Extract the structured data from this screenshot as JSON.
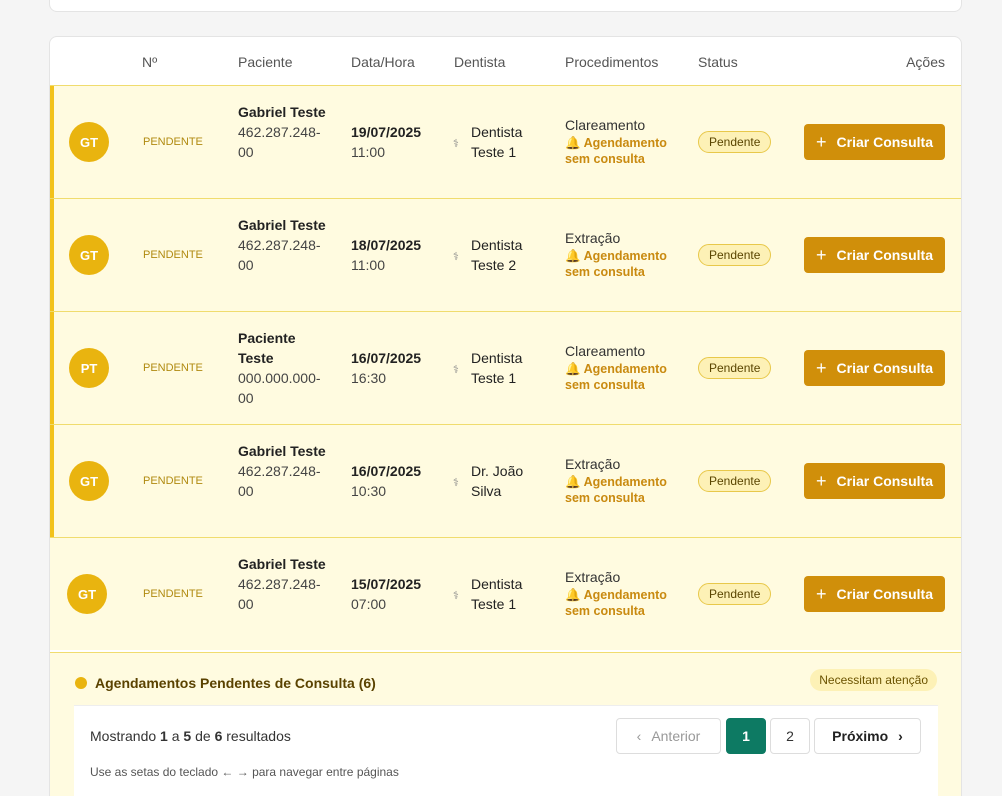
{
  "table": {
    "headers": {
      "num": "Nº",
      "patient": "Paciente",
      "datetime": "Data/Hora",
      "dentist": "Dentista",
      "procedures": "Procedimentos",
      "status": "Status",
      "actions": "Ações"
    },
    "rows": [
      {
        "initials": "GT",
        "num": "PENDENTE",
        "name": "Gabriel Teste",
        "cpf": "462.287.248-00",
        "date": "19/07/2025",
        "time": "11:00",
        "dentist": "Dentista Teste 1",
        "procedure": "Clareamento",
        "warning": "🔔 Agendamento sem consulta",
        "status": "Pendente",
        "action": "Criar Consulta"
      },
      {
        "initials": "GT",
        "num": "PENDENTE",
        "name": "Gabriel Teste",
        "cpf": "462.287.248-00",
        "date": "18/07/2025",
        "time": "11:00",
        "dentist": "Dentista Teste 2",
        "procedure": "Extração",
        "warning": "🔔 Agendamento sem consulta",
        "status": "Pendente",
        "action": "Criar Consulta"
      },
      {
        "initials": "PT",
        "num": "PENDENTE",
        "name": "Paciente Teste",
        "cpf": "000.000.000-00",
        "date": "16/07/2025",
        "time": "16:30",
        "dentist": "Dentista Teste 1",
        "procedure": "Clareamento",
        "warning": "🔔 Agendamento sem consulta",
        "status": "Pendente",
        "action": "Criar Consulta"
      },
      {
        "initials": "GT",
        "num": "PENDENTE",
        "name": "Gabriel Teste",
        "cpf": "462.287.248-00",
        "date": "16/07/2025",
        "time": "10:30",
        "dentist": "Dr. João Silva",
        "procedure": "Extração",
        "warning": "🔔 Agendamento sem consulta",
        "status": "Pendente",
        "action": "Criar Consulta"
      },
      {
        "initials": "GT",
        "num": "PENDENTE",
        "name": "Gabriel Teste",
        "cpf": "462.287.248-00",
        "date": "15/07/2025",
        "time": "07:00",
        "dentist": "Dentista Teste 1",
        "procedure": "Extração",
        "warning": "🔔 Agendamento sem consulta",
        "status": "Pendente",
        "action": "Criar Consulta"
      }
    ]
  },
  "summary": {
    "title": "Agendamentos Pendentes de Consulta (6)",
    "attention": "Necessitam atenção"
  },
  "pagination": {
    "showing_prefix": "Mostrando ",
    "from": "1",
    "sep1": " a ",
    "to": "5",
    "sep2": " de ",
    "total": "6",
    "suffix": " resultados",
    "prev": "Anterior",
    "page1": "1",
    "page2": "2",
    "next": "Próximo",
    "hint": "Use as setas do teclado ← → para navegar entre páginas"
  },
  "icons": {
    "stethoscope": "stethoscope-icon",
    "bell": "bell-icon",
    "plus": "plus-icon"
  },
  "colors": {
    "accent": "#d08f0a",
    "avatar": "#e9b40f",
    "row_bg": "#fffbe0",
    "active_page": "#0d7a63"
  }
}
